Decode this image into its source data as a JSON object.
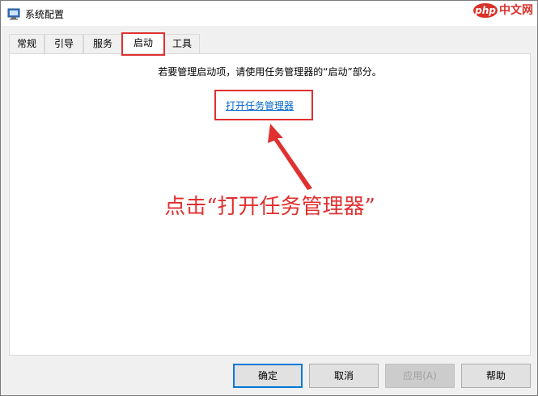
{
  "window": {
    "title": "系统配置"
  },
  "watermark": {
    "brand": "php",
    "site": "中文网"
  },
  "tabs": [
    {
      "label": "常规"
    },
    {
      "label": "引导"
    },
    {
      "label": "服务"
    },
    {
      "label": "启动",
      "selected": true
    },
    {
      "label": "工具"
    }
  ],
  "startup": {
    "instruction": "若要管理启动项，请使用任务管理器的“启动”部分。",
    "link_label": "打开任务管理器"
  },
  "annotation": {
    "callout": "点击“打开任务管理器”",
    "color": "#e03030"
  },
  "buttons": {
    "ok": "确定",
    "cancel": "取消",
    "apply": "应用(A)",
    "help": "帮助"
  },
  "colors": {
    "link": "#0066cc",
    "focus_border": "#0078d7"
  }
}
